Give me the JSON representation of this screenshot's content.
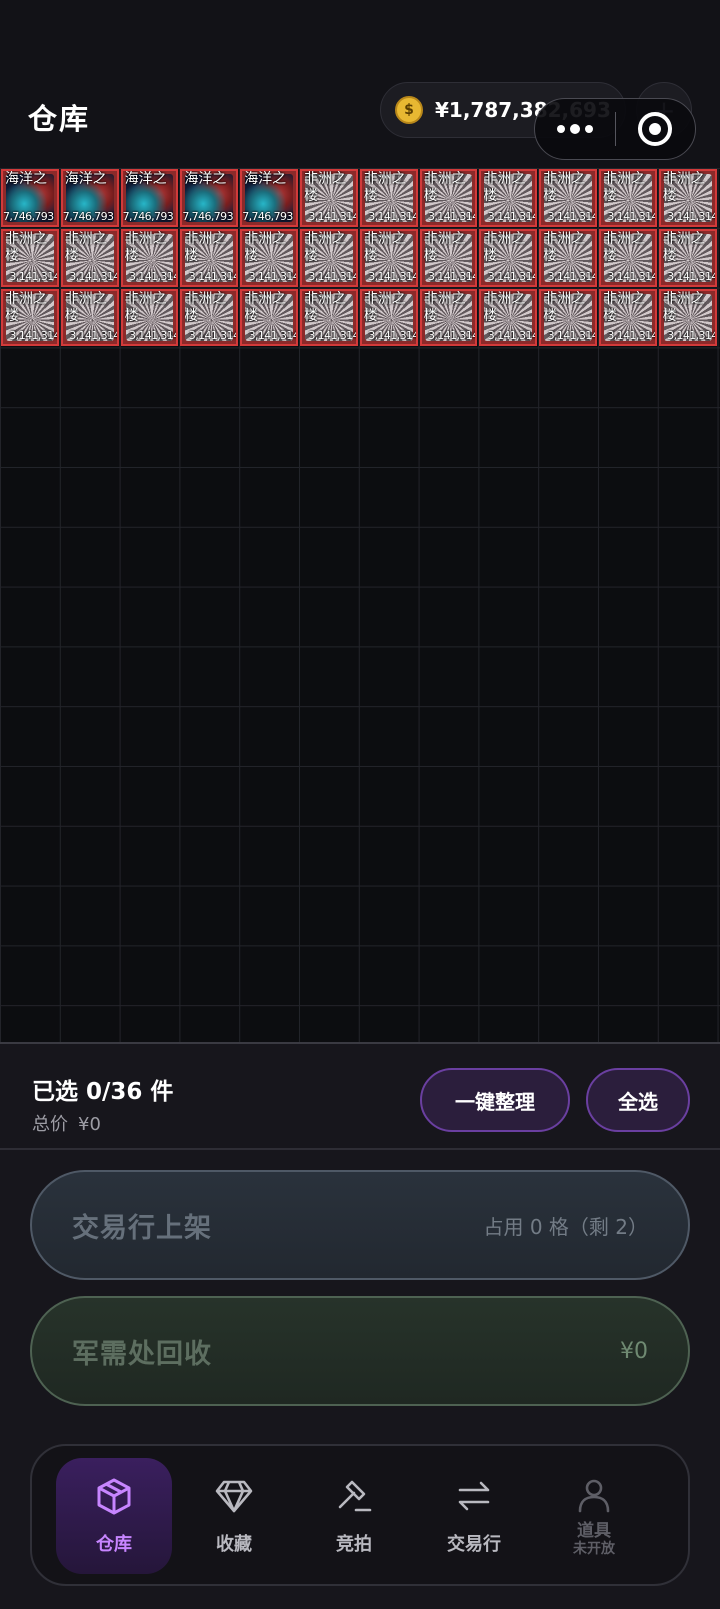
{
  "header": {
    "title": "仓库",
    "balance": "¥1,787,382,693",
    "coin_symbol": "$",
    "plus_label": "+"
  },
  "inventory": {
    "ocean_name": "海洋之",
    "ocean_price": "7,746,793",
    "africa_name": "非洲之",
    "africa_name_2": "楼",
    "africa_price": "3,141,314",
    "slots": [
      "ocean",
      "ocean",
      "ocean",
      "ocean",
      "ocean",
      "africa",
      "africa",
      "africa",
      "africa",
      "africa",
      "africa",
      "africa",
      "africa",
      "africa",
      "africa",
      "africa",
      "africa",
      "africa",
      "africa",
      "africa",
      "africa",
      "africa",
      "africa",
      "africa",
      "africa",
      "africa",
      "africa",
      "africa",
      "africa",
      "africa",
      "africa",
      "africa",
      "africa",
      "africa",
      "africa",
      "africa"
    ],
    "item_border_color": "#d23a3a"
  },
  "selection": {
    "selected_text": "已选 0/36 件",
    "total_label": "总价",
    "total_value": "¥0",
    "organize_label": "一键整理",
    "select_all_label": "全选"
  },
  "actions": {
    "market_label": "交易行上架",
    "market_side": "占用 0 格（剩 2）",
    "recycle_label": "军需处回收",
    "recycle_side": "¥0"
  },
  "nav": {
    "items": [
      {
        "label": "仓库",
        "icon": "box-icon",
        "active": true
      },
      {
        "label": "收藏",
        "icon": "diamond-icon"
      },
      {
        "label": "竞拍",
        "icon": "gavel-icon"
      },
      {
        "label": "交易行",
        "icon": "swap-icon"
      },
      {
        "label": "道具",
        "sub": "未开放",
        "icon": "user-icon",
        "disabled": true
      }
    ]
  },
  "colors": {
    "accent": "#c785ff",
    "background": "#121217"
  }
}
